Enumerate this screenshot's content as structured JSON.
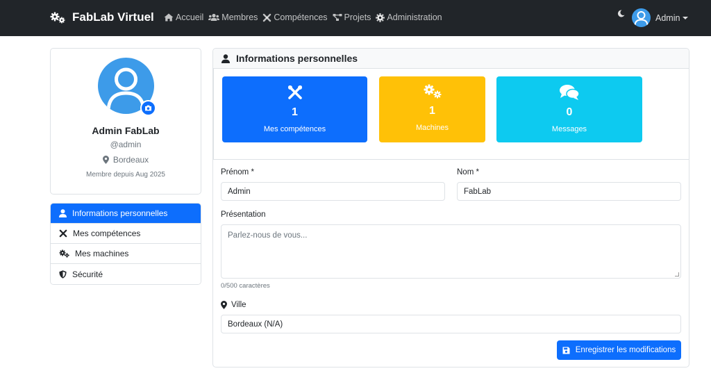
{
  "navbar": {
    "brand": "FabLab Virtuel",
    "links": [
      {
        "label": "Accueil",
        "icon": "home-icon"
      },
      {
        "label": "Membres",
        "icon": "users-icon"
      },
      {
        "label": "Compétences",
        "icon": "tools-icon"
      },
      {
        "label": "Projets",
        "icon": "project-diagram-icon"
      },
      {
        "label": "Administration",
        "icon": "gear-icon"
      }
    ],
    "user_label": "Admin"
  },
  "profile": {
    "name": "Admin FabLab",
    "username": "@admin",
    "city": "Bordeaux",
    "member_since": "Membre depuis Aug 2025"
  },
  "side_menu": [
    {
      "label": "Informations personnelles",
      "icon": "user-icon",
      "active": true
    },
    {
      "label": "Mes compétences",
      "icon": "tools-icon",
      "active": false
    },
    {
      "label": "Mes machines",
      "icon": "gears-icon",
      "active": false
    },
    {
      "label": "Sécurité",
      "icon": "shield-icon",
      "active": false
    }
  ],
  "main": {
    "title": "Informations personnelles",
    "stats": [
      {
        "value": "1",
        "label": "Mes compétences",
        "color": "#0d6efd",
        "icon": "tools-icon"
      },
      {
        "value": "1",
        "label": "Machines",
        "color": "#ffc107",
        "icon": "gears-icon"
      },
      {
        "value": "0",
        "label": "Messages",
        "color": "#0dcaf0",
        "icon": "comments-icon"
      }
    ],
    "form": {
      "prenom_label": "Prénom *",
      "prenom_value": "Admin",
      "nom_label": "Nom *",
      "nom_value": "FabLab",
      "presentation_label": "Présentation",
      "presentation_placeholder": "Parlez-nous de vous...",
      "char_count": "0/500 caractères",
      "ville_label": "Ville",
      "ville_value": "Bordeaux (N/A)",
      "save_label": "Enregistrer les modifications"
    }
  },
  "colors": {
    "navbar_bg": "#212529",
    "primary": "#0d6efd",
    "warning": "#ffc107",
    "info": "#0dcaf0",
    "avatar": "#3d9be9"
  }
}
